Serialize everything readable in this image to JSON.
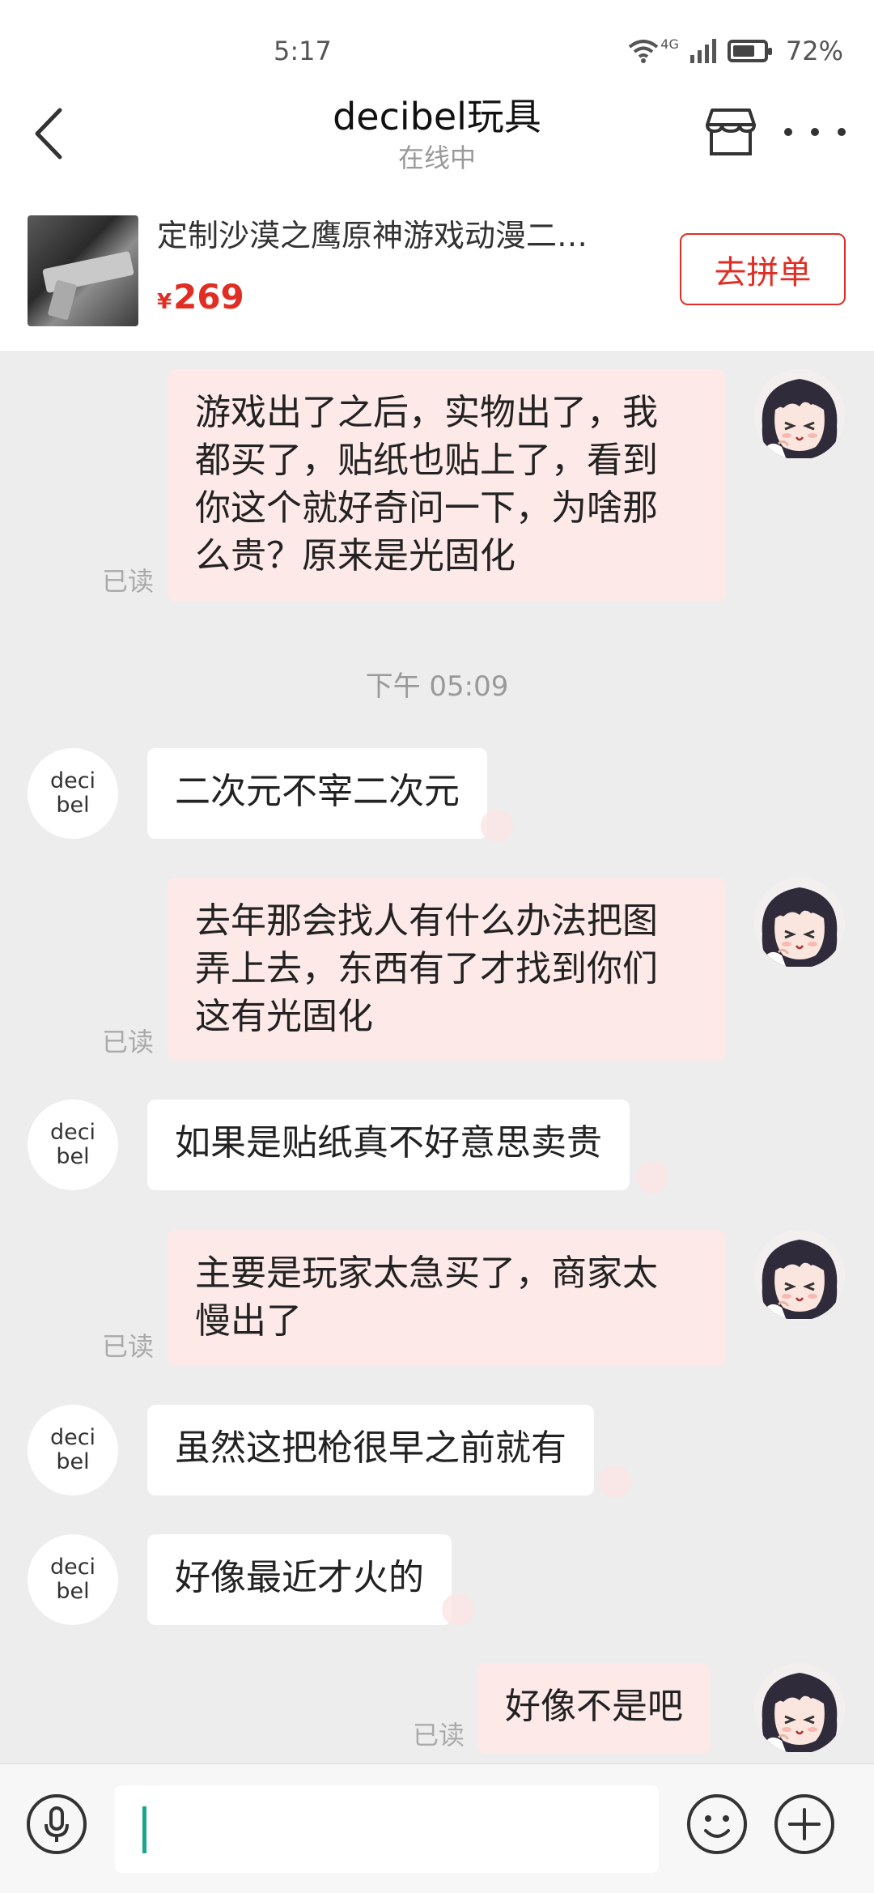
{
  "status_bar": {
    "time": "5:17",
    "signal": "4G",
    "battery_percent": "72%",
    "battery_level": 0.72
  },
  "header": {
    "title": "decibel玩具",
    "subtitle": "在线中"
  },
  "product": {
    "title": "定制沙漠之鹰原神游戏动漫二…",
    "currency": "¥",
    "price": "269",
    "button_label": "去拼单"
  },
  "messages": [
    {
      "from": "me",
      "text": "游戏出了之后，实物出了，我\n都买了，贴纸也贴上了，看到\n你这个就好奇问一下，为啥那\n么贵？原来是光固化",
      "read": "已读"
    },
    {
      "timestamp": "下午 05:09"
    },
    {
      "from": "them",
      "avatar": "deci\nbel",
      "text": "二次元不宰二次元"
    },
    {
      "from": "me",
      "text": "去年那会找人有什么办法把图\n弄上去，东西有了才找到你们\n这有光固化",
      "read": "已读"
    },
    {
      "from": "them",
      "avatar": "deci\nbel",
      "text": "如果是贴纸真不好意思卖贵"
    },
    {
      "from": "me",
      "text": "主要是玩家太急买了，商家太\n慢出了",
      "read": "已读"
    },
    {
      "from": "them",
      "avatar": "deci\nbel",
      "text": "虽然这把枪很早之前就有"
    },
    {
      "from": "them",
      "avatar": "deci\nbel",
      "text": "好像最近才火的"
    },
    {
      "from": "me",
      "text": "好像不是吧",
      "read": "已读"
    }
  ],
  "input_bar": {
    "placeholder": "",
    "icons": [
      "microphone-icon",
      "emoji-icon",
      "plus-icon"
    ]
  },
  "colors": {
    "accent": "#e02e24",
    "my_bubble": "#fde9e8",
    "background": "#ededed",
    "caret": "#1aa58c"
  }
}
